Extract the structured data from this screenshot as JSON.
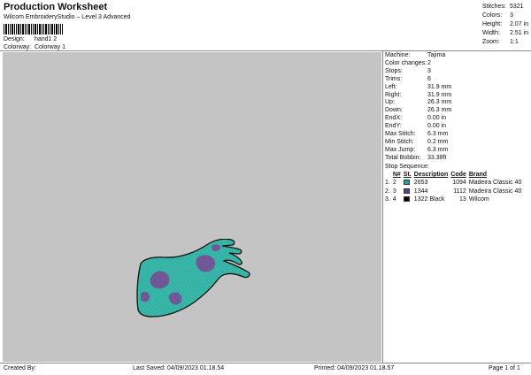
{
  "header": {
    "title": "Production Worksheet",
    "subtitle": "Wilcom EmbroideryStudio – Level 3 Advanced",
    "design_label": "Design:",
    "design_value": "hand1 2",
    "colorway_label": "Colorway:",
    "colorway_value": "Colorway 1"
  },
  "top_stats": [
    {
      "label": "Stitches:",
      "value": "5321"
    },
    {
      "label": "Colors:",
      "value": "3"
    },
    {
      "label": "Height:",
      "value": "2.07 in"
    },
    {
      "label": "Width:",
      "value": "2.51 in"
    },
    {
      "label": "Zoom:",
      "value": "1:1"
    }
  ],
  "machine_info": [
    {
      "label": "Machine:",
      "value": "Tajima"
    },
    {
      "label": "Color changes:",
      "value": "2"
    },
    {
      "label": "Stops:",
      "value": "3"
    },
    {
      "label": "Trims:",
      "value": "6"
    },
    {
      "label": "Left:",
      "value": "31.9 mm"
    },
    {
      "label": "Right:",
      "value": "31.9 mm"
    },
    {
      "label": "Up:",
      "value": "26.3 mm"
    },
    {
      "label": "Down:",
      "value": "26.3 mm"
    },
    {
      "label": "EndX:",
      "value": "0.00 in"
    },
    {
      "label": "EndY:",
      "value": "0.00 in"
    },
    {
      "label": "Max Stitch:",
      "value": "6.3 mm"
    },
    {
      "label": "Min Stitch:",
      "value": "0.2 mm"
    },
    {
      "label": "Max Jump:",
      "value": "6.3 mm"
    },
    {
      "label": "Total Bobbin:",
      "value": "33.38ft"
    }
  ],
  "stop_sequence": {
    "title": "Stop Sequence:",
    "headers": {
      "n": "N#",
      "st": "St.",
      "desc": "Description",
      "code": "Code",
      "brand": "Brand"
    },
    "rows": [
      {
        "idx": "1.",
        "n": "2",
        "color": "#1aa6a6",
        "desc": "2653",
        "st": "1094",
        "brand": "Madeira Classic 40"
      },
      {
        "idx": "2.",
        "n": "3",
        "color": "#5b3f8a",
        "desc": "1344",
        "st": "1112",
        "brand": "Madeira Classic 40"
      },
      {
        "idx": "3.",
        "n": "4",
        "color": "#000000",
        "desc": "1322 Black",
        "st": "13",
        "brand": "Wilcom"
      }
    ]
  },
  "footer": {
    "created_by": "Created By:",
    "last_saved": "Last Saved: 04/09/2023 01.18.54",
    "printed": "Printed: 04/09/2023 01.18.57",
    "page": "Page 1 of 1"
  },
  "colors": {
    "canvas_bg": "#c4c4c4",
    "teal": "#38b8aa",
    "purple": "#6f5896",
    "outline": "#111111"
  }
}
